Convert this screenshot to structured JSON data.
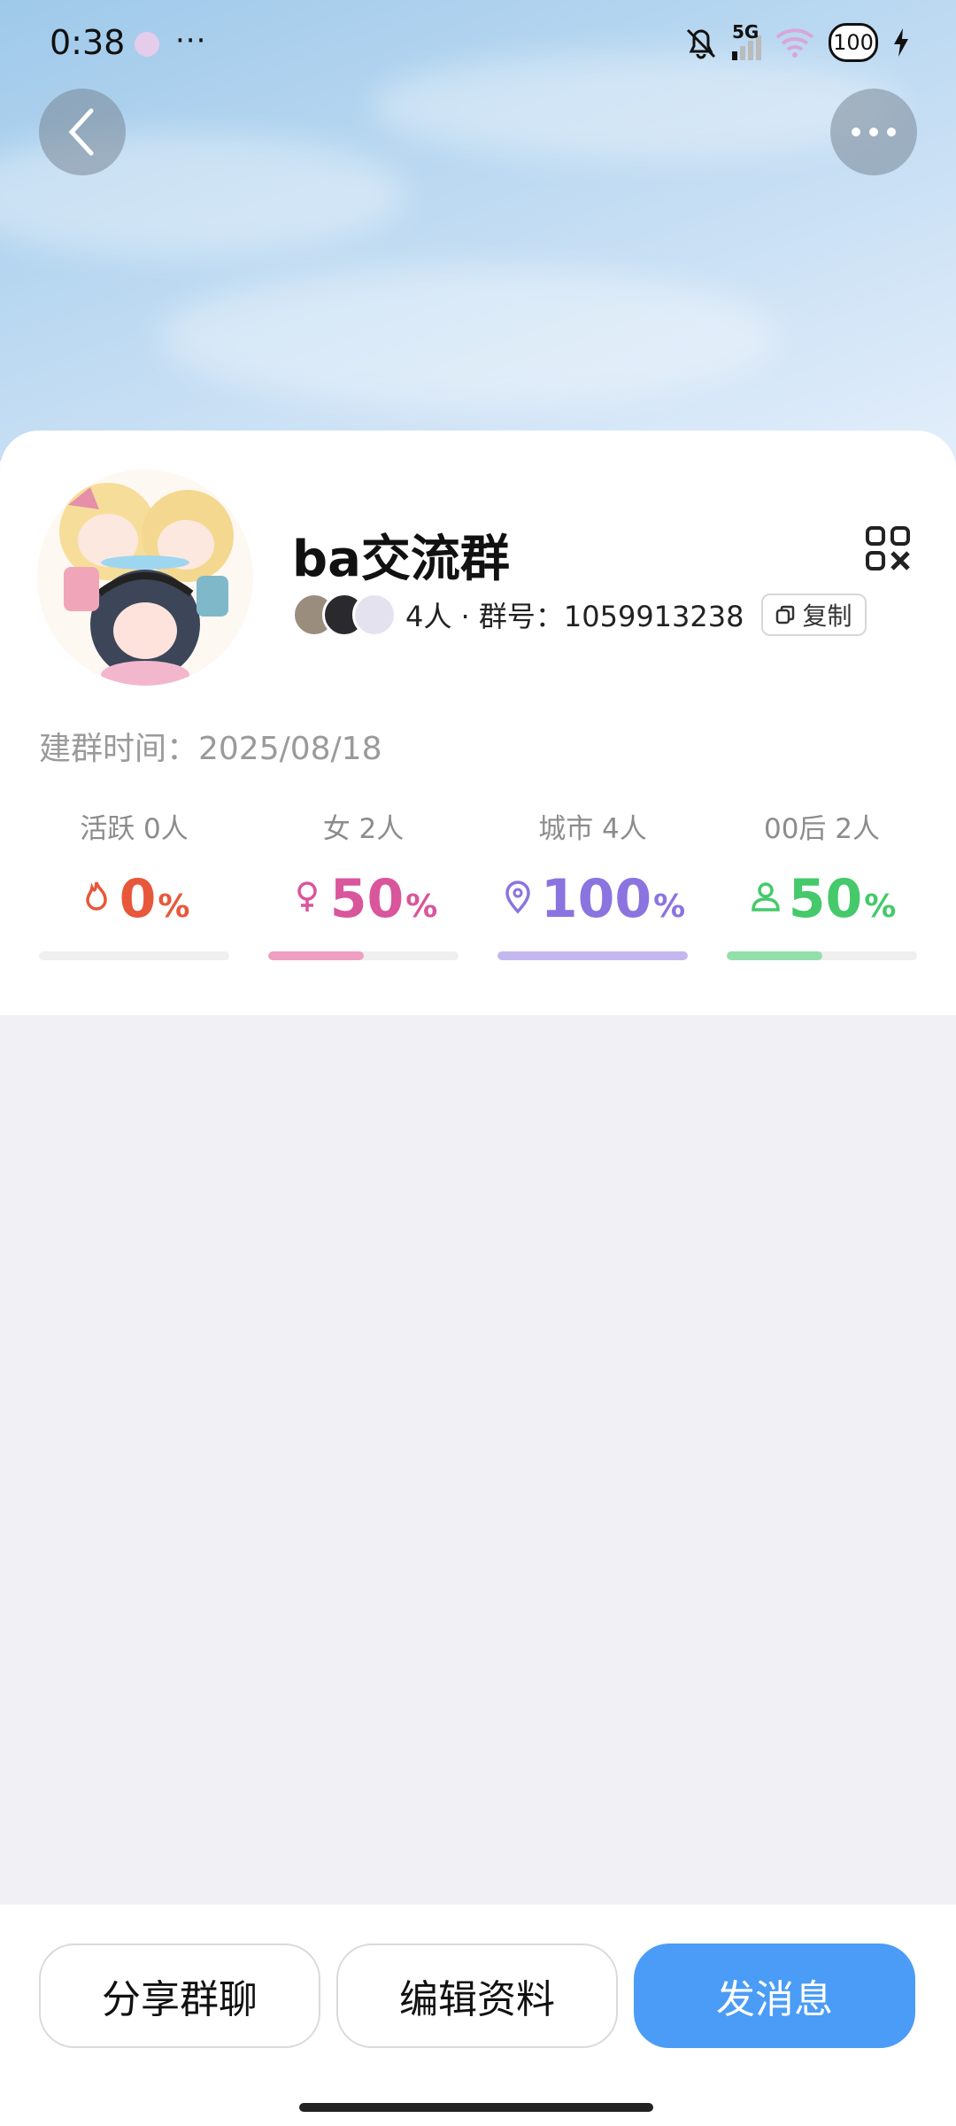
{
  "status_bar": {
    "time": "0:38",
    "network": "5G",
    "battery": "100"
  },
  "group": {
    "name": "ba交流群",
    "members_text": "4人 · 群号：1059913238",
    "copy_label": "复制",
    "created_text": "建群时间：2025/08/18"
  },
  "stats": [
    {
      "label": "活跃 0人",
      "value": "0",
      "unit": "%",
      "icon": "flame-icon",
      "color": "#e8573a",
      "fill": 0
    },
    {
      "label": "女 2人",
      "value": "50",
      "unit": "%",
      "icon": "female-icon",
      "color": "#d9559c",
      "fill": 50
    },
    {
      "label": "城市 4人",
      "value": "100",
      "unit": "%",
      "icon": "location-pin-icon",
      "color": "#8b74e0",
      "fill": 100
    },
    {
      "label": "00后 2人",
      "value": "50",
      "unit": "%",
      "icon": "person-icon",
      "color": "#45c96a",
      "fill": 50
    }
  ],
  "bar_colors": [
    "#e8573a",
    "#ef9fc1",
    "#c3b7f0",
    "#93dfa9"
  ],
  "actions": {
    "share": "分享群聊",
    "edit": "编辑资料",
    "send": "发消息"
  },
  "colors": {
    "accent": "#4a9cf6"
  }
}
